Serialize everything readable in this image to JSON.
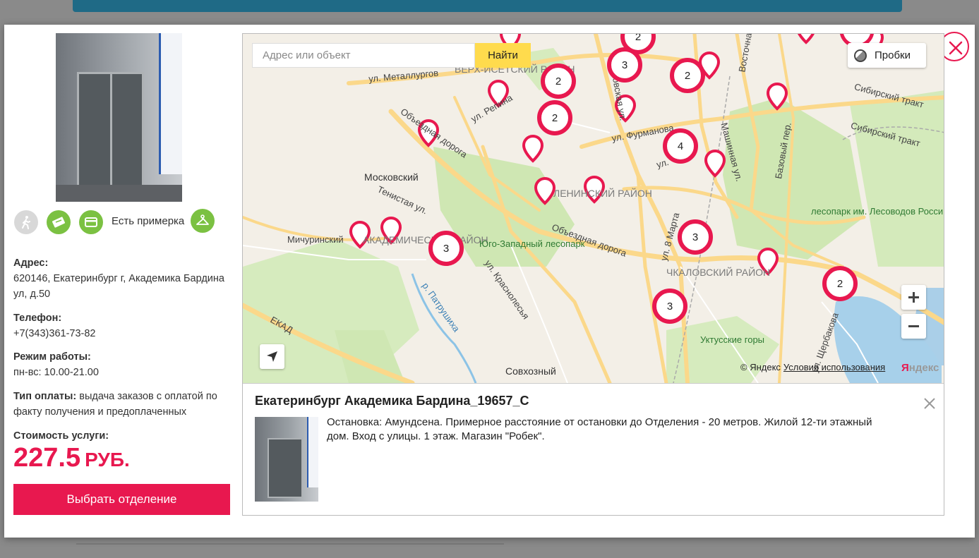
{
  "colors": {
    "accent": "#e8184f",
    "feature_green": "#7bc142",
    "feature_gray": "#d8d8d8",
    "header_blue": "#1f6a86",
    "search_button": "#ffdb4d"
  },
  "left": {
    "features": [
      {
        "icon": "walking-person-icon",
        "active": false
      },
      {
        "icon": "voucher-icon",
        "active": true
      },
      {
        "icon": "credit-card-icon",
        "active": true
      },
      {
        "icon": "hanger-icon",
        "active": true
      }
    ],
    "fitting_label": "Есть примерка",
    "address_label": "Адрес:",
    "address_value": "620146, Екатеринбург г, Академика Бардина ул, д.50",
    "phone_label": "Телефон:",
    "phone_value": "+7(343)361-73-82",
    "hours_label": "Режим работы:",
    "hours_value": "пн-вс: 10.00-21.00",
    "payment_label": "Тип оплаты:",
    "payment_value": "выдача заказов с оплатой по факту получения и предоплаченных",
    "cost_label": "Стоимость услуги:",
    "price_value": "227.5",
    "price_currency": "РУБ.",
    "select_button": "Выбрать отделение"
  },
  "map": {
    "search_placeholder": "Адрес или объект",
    "find_button": "Найти",
    "traffic_button": "Пробки",
    "copyright": "© Яндекс",
    "terms_link": "Условия использования",
    "logo_y": "Я",
    "logo_rest": "ндекс",
    "clusters": [
      "2",
      "3",
      "2",
      "2",
      "2",
      "4",
      "3",
      "3",
      "3",
      "2"
    ],
    "streets": [
      "ул. Металлургов",
      "Объездная дорога",
      "ул. Репина",
      "Московская ул.",
      "ул. Фурманова",
      "Машинная ул.",
      "Базовый пер.",
      "Сибирский тракт",
      "Сибирский тракт",
      "Тенистая ул.",
      "Объездная дорога",
      "ул. Краснолесья",
      "р. Патрушиха",
      "ЕКАД",
      "ул. 8 Марта",
      "ул. Щербакова",
      "Восточная ул.",
      "ул."
    ],
    "districts": [
      "ВЕРХ-ИСЕТСКИЙ РАЙОН",
      "ЛЕНИНСКИЙ РАЙОН",
      "АКАДЕМИЧЕСКИЙ РАЙОН",
      "ЧКАЛОВСКИЙ РАЙОН"
    ],
    "places": [
      "Московский",
      "Мичуринский",
      "Совхозный"
    ],
    "parks": [
      "Юго-Западный лесопарк",
      "лесопарк им. Лесоводов России",
      "Уктусские горы"
    ]
  },
  "balloon": {
    "title": "Екатеринбург Академика Бардина_19657_С",
    "description": "Остановка: Амундсена. Примерное расстояние от остановки до Отделения - 20 метров. Жилой 12-ти этажный дом. Вход с улицы. 1 этаж. Магазин \"Робек\"."
  }
}
